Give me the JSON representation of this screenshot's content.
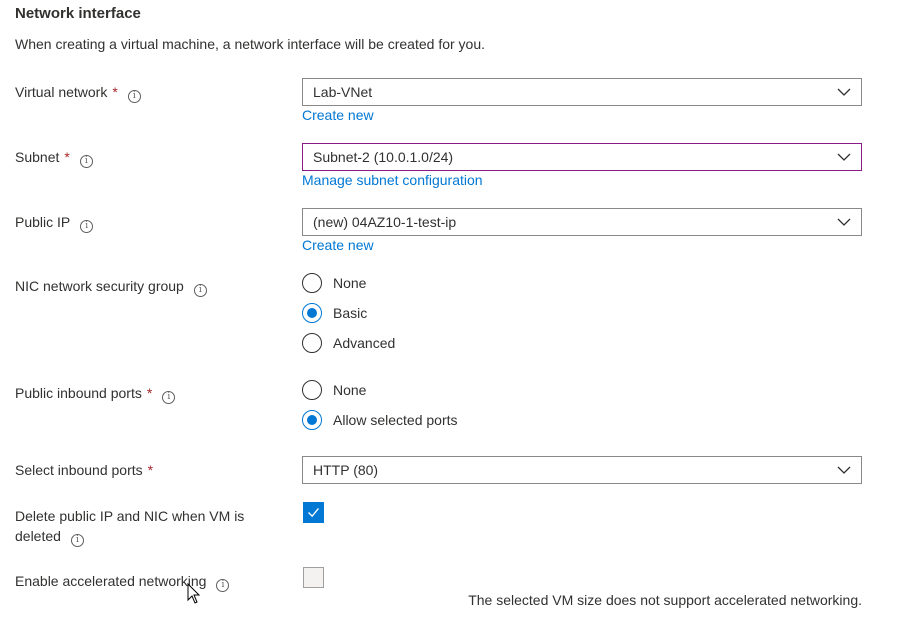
{
  "section": {
    "title": "Network interface",
    "description": "When creating a virtual machine, a network interface will be created for you."
  },
  "virtual_network": {
    "label": "Virtual network",
    "required_mark": "*",
    "value": "Lab-VNet",
    "link": "Create new"
  },
  "subnet": {
    "label": "Subnet",
    "required_mark": "*",
    "value": "Subnet-2 (10.0.1.0/24)",
    "link": "Manage subnet configuration"
  },
  "public_ip": {
    "label": "Public IP",
    "value": "(new) 04AZ10-1-test-ip",
    "link": "Create new"
  },
  "nic_nsg": {
    "label": "NIC network security group",
    "options": [
      "None",
      "Basic",
      "Advanced"
    ],
    "selected": "Basic"
  },
  "public_inbound": {
    "label": "Public inbound ports",
    "required_mark": "*",
    "options": [
      "None",
      "Allow selected ports"
    ],
    "selected": "Allow selected ports"
  },
  "select_inbound": {
    "label": "Select inbound ports",
    "required_mark": "*",
    "value": "HTTP (80)"
  },
  "delete_ip": {
    "label_line1": "Delete public IP and NIC when VM is",
    "label_line2": "deleted",
    "checked": true
  },
  "accel_net": {
    "label": "Enable accelerated networking",
    "checked": false,
    "note": "The selected VM size does not support accelerated networking."
  },
  "colors": {
    "accent": "#0078d4",
    "required": "#a4262c",
    "focus_border": "#8b1a89"
  },
  "icons": [
    "info-icon",
    "chevron-down-icon",
    "checkmark-icon",
    "mouse-cursor-icon"
  ]
}
